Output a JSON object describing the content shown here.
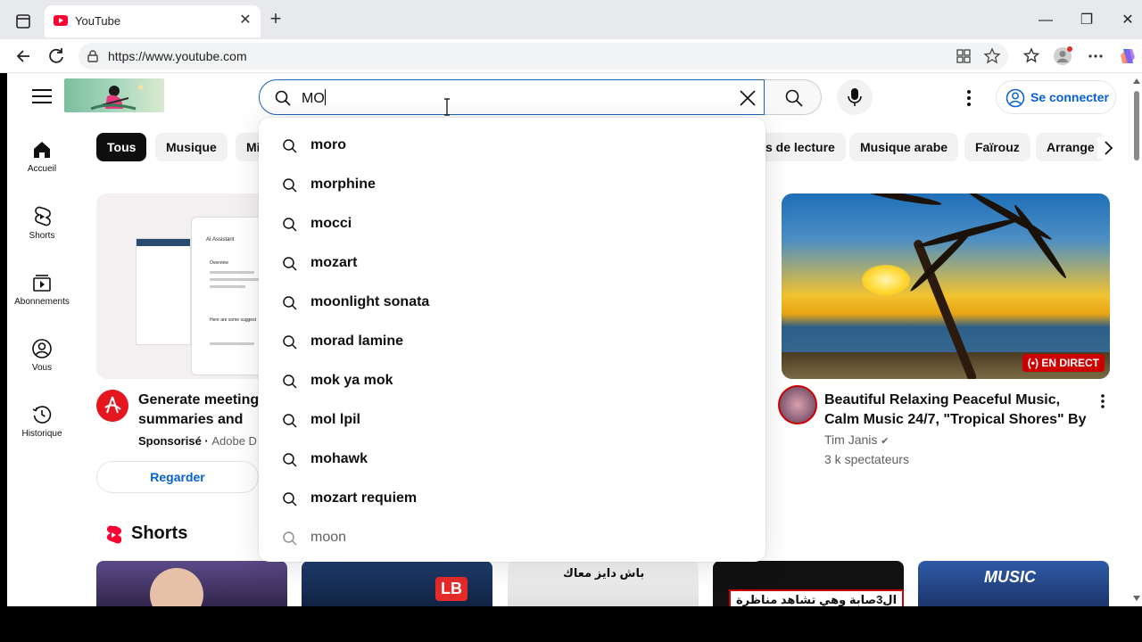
{
  "browser": {
    "tab_title": "YouTube",
    "url": "https://www.youtube.com"
  },
  "header": {
    "search_value": "MO",
    "signin_label": "Se connecter"
  },
  "sidebar": {
    "items": [
      {
        "label": "Accueil"
      },
      {
        "label": "Shorts"
      },
      {
        "label": "Abonnements"
      },
      {
        "label": "Vous"
      },
      {
        "label": "Historique"
      }
    ]
  },
  "chips": [
    "Tous",
    "Musique",
    "Mi",
    "s de lecture",
    "Musique arabe",
    "Faïrouz",
    "Arrange"
  ],
  "suggestions": [
    "moro",
    "morphine",
    "mocci",
    "mozart",
    "moonlight sonata",
    "morad lamine",
    "mok ya mok",
    "mol lpil",
    "mohawk",
    "mozart requiem",
    "moon"
  ],
  "ad": {
    "thumb_title": "AI Assistant",
    "thumb_overview": "Overview",
    "thumb_prompt": "Here are some suggest",
    "title": "Generate meeting summaries and action items with Acrobat",
    "sponsored": "Sponsorisé",
    "sponsor_name": "Adobe D",
    "watch_label": "Regarder"
  },
  "live": {
    "badge": "EN DIRECT",
    "title": "Beautiful Relaxing Peaceful Music, Calm Music 24/7, \"Tropical Shores\" By Tim ...",
    "channel": "Tim Janis",
    "viewers": "3 k spectateurs"
  },
  "shorts": {
    "heading": "Shorts",
    "items": [
      {
        "text": ""
      },
      {
        "text": "LB"
      },
      {
        "text": "باش دايز معاك"
      },
      {
        "text": "ال3صابة وهي تشاهد مناظرة"
      },
      {
        "text": "MUSIC"
      }
    ]
  },
  "colors": {
    "youtube_red": "#ff0033",
    "link_blue": "#065fd4",
    "search_focus": "#1c62b9"
  }
}
